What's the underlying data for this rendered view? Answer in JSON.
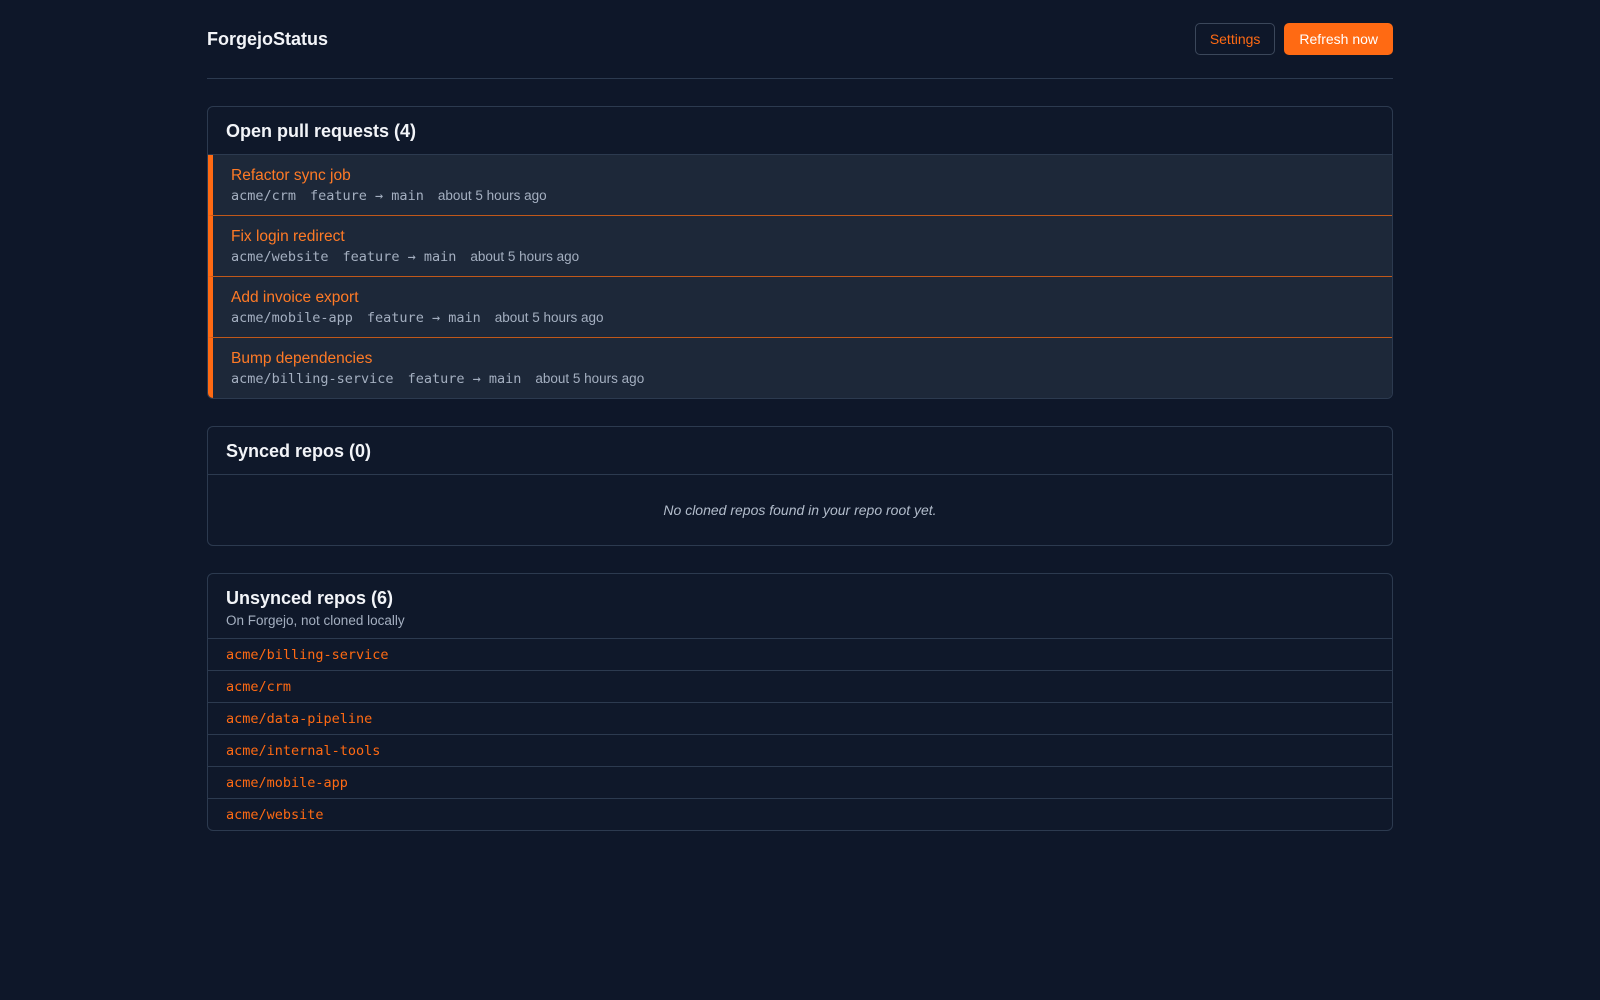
{
  "header": {
    "app_title": "ForgejoStatus",
    "settings_label": "Settings",
    "refresh_label": "Refresh now"
  },
  "pull_requests": {
    "title": "Open pull requests (4)",
    "items": [
      {
        "title": "Refactor sync job",
        "repo": "acme/crm",
        "branch": "feature → main",
        "time": "about 5 hours ago"
      },
      {
        "title": "Fix login redirect",
        "repo": "acme/website",
        "branch": "feature → main",
        "time": "about 5 hours ago"
      },
      {
        "title": "Add invoice export",
        "repo": "acme/mobile-app",
        "branch": "feature → main",
        "time": "about 5 hours ago"
      },
      {
        "title": "Bump dependencies",
        "repo": "acme/billing-service",
        "branch": "feature → main",
        "time": "about 5 hours ago"
      }
    ]
  },
  "synced": {
    "title": "Synced repos (0)",
    "empty_message": "No cloned repos found in your repo root yet."
  },
  "unsynced": {
    "title": "Unsynced repos (6)",
    "subtitle": "On Forgejo, not cloned locally",
    "repos": [
      "acme/billing-service",
      "acme/crm",
      "acme/data-pipeline",
      "acme/internal-tools",
      "acme/mobile-app",
      "acme/website"
    ]
  },
  "colors": {
    "accent": "#ff6a13",
    "background": "#0e1729",
    "panel_row": "#1d2839",
    "muted_text": "#a4afc0"
  }
}
